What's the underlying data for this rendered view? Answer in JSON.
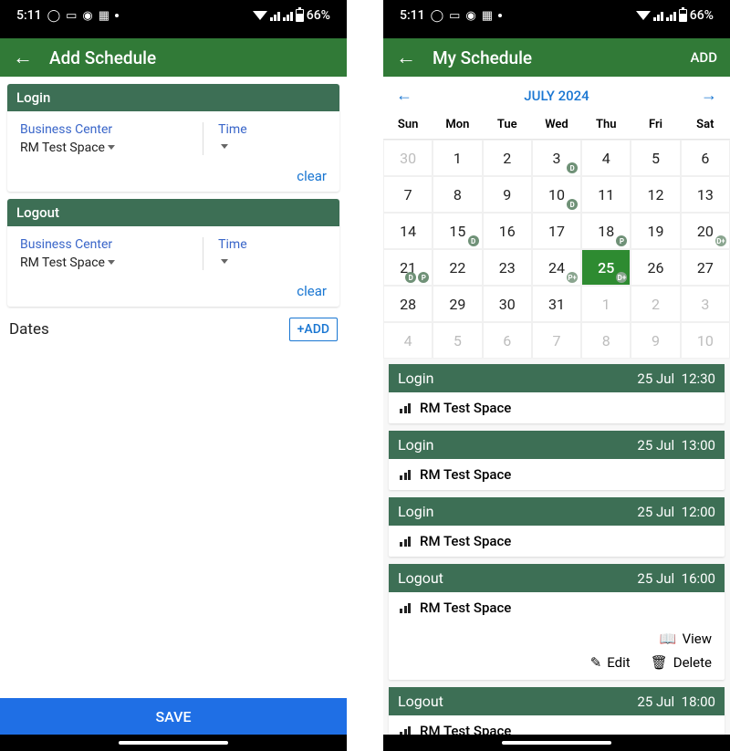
{
  "status": {
    "time": "5:11",
    "battery": "66%"
  },
  "left": {
    "title": "Add Schedule",
    "save": "SAVE",
    "login": {
      "header": "Login",
      "bc_label": "Business Center",
      "bc_value": "RM Test Space",
      "time_label": "Time",
      "clear": "clear"
    },
    "logout": {
      "header": "Logout",
      "bc_label": "Business Center",
      "bc_value": "RM Test Space",
      "time_label": "Time",
      "clear": "clear"
    },
    "dates": {
      "label": "Dates",
      "add": "+ADD"
    }
  },
  "right": {
    "title": "My Schedule",
    "action": "ADD",
    "month": "JULY 2024",
    "dayheaders": [
      "Sun",
      "Mon",
      "Tue",
      "Wed",
      "Thu",
      "Fri",
      "Sat"
    ],
    "weeks": [
      [
        {
          "d": "30",
          "o": true
        },
        {
          "d": "1"
        },
        {
          "d": "2"
        },
        {
          "d": "3",
          "b": [
            "D"
          ]
        },
        {
          "d": "4"
        },
        {
          "d": "5"
        },
        {
          "d": "6"
        }
      ],
      [
        {
          "d": "7"
        },
        {
          "d": "8"
        },
        {
          "d": "9"
        },
        {
          "d": "10",
          "b": [
            "D"
          ]
        },
        {
          "d": "11"
        },
        {
          "d": "12"
        },
        {
          "d": "13"
        }
      ],
      [
        {
          "d": "14"
        },
        {
          "d": "15",
          "b": [
            "D"
          ]
        },
        {
          "d": "16"
        },
        {
          "d": "17"
        },
        {
          "d": "18",
          "b": [
            "P"
          ]
        },
        {
          "d": "19"
        },
        {
          "d": "20",
          "b": [
            "D+"
          ]
        }
      ],
      [
        {
          "d": "21",
          "b": [
            "D",
            "P"
          ]
        },
        {
          "d": "22"
        },
        {
          "d": "23"
        },
        {
          "d": "24",
          "b": [
            "P+"
          ]
        },
        {
          "d": "25",
          "sel": true,
          "b": [
            "D+"
          ]
        },
        {
          "d": "26"
        },
        {
          "d": "27"
        }
      ],
      [
        {
          "d": "28"
        },
        {
          "d": "29"
        },
        {
          "d": "30"
        },
        {
          "d": "31"
        },
        {
          "d": "1",
          "o": true
        },
        {
          "d": "2",
          "o": true
        },
        {
          "d": "3",
          "o": true
        }
      ],
      [
        {
          "d": "4",
          "o": true
        },
        {
          "d": "5",
          "o": true
        },
        {
          "d": "6",
          "o": true
        },
        {
          "d": "7",
          "o": true
        },
        {
          "d": "8",
          "o": true
        },
        {
          "d": "9",
          "o": true
        },
        {
          "d": "10",
          "o": true
        }
      ]
    ],
    "events": [
      {
        "type": "Login",
        "date": "25 Jul",
        "time": "12:30",
        "space": "RM Test Space"
      },
      {
        "type": "Login",
        "date": "25 Jul",
        "time": "13:00",
        "space": "RM Test Space"
      },
      {
        "type": "Login",
        "date": "25 Jul",
        "time": "12:00",
        "space": "RM Test Space"
      },
      {
        "type": "Logout",
        "date": "25 Jul",
        "time": "16:00",
        "space": "RM Test Space",
        "expanded": true
      },
      {
        "type": "Logout",
        "date": "25 Jul",
        "time": "18:00",
        "space": "RM Test Space"
      }
    ],
    "actions": {
      "view": "View",
      "edit": "Edit",
      "delete": "Delete"
    }
  }
}
